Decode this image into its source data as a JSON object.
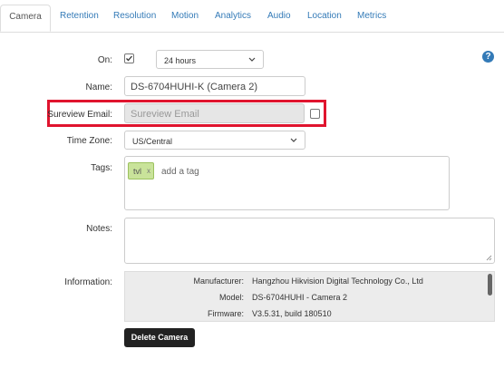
{
  "tabs": [
    {
      "label": "Camera"
    },
    {
      "label": "Retention"
    },
    {
      "label": "Resolution"
    },
    {
      "label": "Motion"
    },
    {
      "label": "Analytics"
    },
    {
      "label": "Audio"
    },
    {
      "label": "Location"
    },
    {
      "label": "Metrics"
    }
  ],
  "help_icon": "question-circle-icon",
  "form": {
    "on": {
      "label": "On:",
      "checked": true,
      "schedule": "24 hours"
    },
    "name": {
      "label": "Name:",
      "value": "DS-6704HUHI-K (Camera 2)"
    },
    "sureview_email": {
      "label": "Sureview Email:",
      "placeholder": "Sureview Email",
      "checked": false
    },
    "time_zone": {
      "label": "Time Zone:",
      "value": "US/Central"
    },
    "tags": {
      "label": "Tags:",
      "items": [
        {
          "text": "tvl",
          "remove": "x"
        }
      ],
      "placeholder": "add a tag"
    },
    "notes": {
      "label": "Notes:",
      "value": ""
    },
    "information": {
      "label": "Information:",
      "rows": [
        {
          "key": "Manufacturer:",
          "value": "Hangzhou Hikvision Digital Technology Co., Ltd"
        },
        {
          "key": "Model:",
          "value": "DS-6704HUHI - Camera 2"
        },
        {
          "key": "Firmware:",
          "value": "V3.5.31, build 180510"
        }
      ]
    }
  },
  "delete_button": "Delete Camera",
  "colors": {
    "link": "#337ab7",
    "highlight": "#e0142e",
    "tag": "#c9e39a",
    "button": "#222222"
  }
}
